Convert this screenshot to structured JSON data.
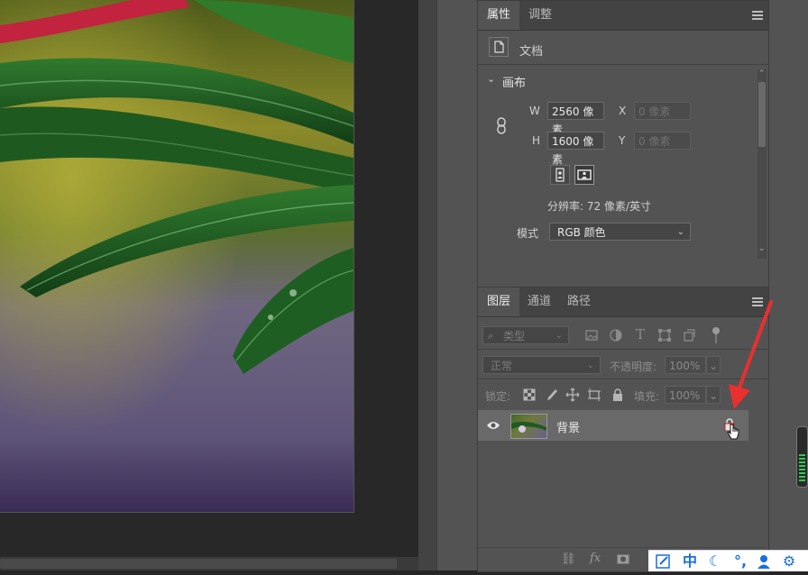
{
  "properties_panel": {
    "tabs": [
      {
        "label": "属性",
        "active": true
      },
      {
        "label": "调整",
        "active": false
      }
    ],
    "doc_label": "文档",
    "canvas_section": "画布",
    "width_label": "W",
    "width_value": "2560 像素",
    "height_label": "H",
    "height_value": "1600 像素",
    "x_label": "X",
    "x_placeholder": "0 像素",
    "y_label": "Y",
    "y_placeholder": "0 像素",
    "resolution_text": "分辨率: 72 像素/英寸",
    "mode_label": "模式",
    "mode_value": "RGB 颜色"
  },
  "layers_panel": {
    "tabs": [
      {
        "label": "图层",
        "active": true
      },
      {
        "label": "通道",
        "active": false
      },
      {
        "label": "路径",
        "active": false
      }
    ],
    "filter_kind": "类型",
    "blend_mode": "正常",
    "opacity_label": "不透明度:",
    "opacity_value": "100%",
    "lock_label": "锁定:",
    "fill_label": "填充:",
    "fill_value": "100%",
    "layers": [
      {
        "name": "背景",
        "visible": true,
        "locked": true
      }
    ]
  },
  "ime_toolbar": {
    "language": "中"
  },
  "colors": {
    "panel_bg": "#535353",
    "tab_bar": "#434343",
    "selected_layer": "#696969",
    "annotation_arrow": "#e8302e",
    "ime_blue": "#1a6fe0"
  }
}
